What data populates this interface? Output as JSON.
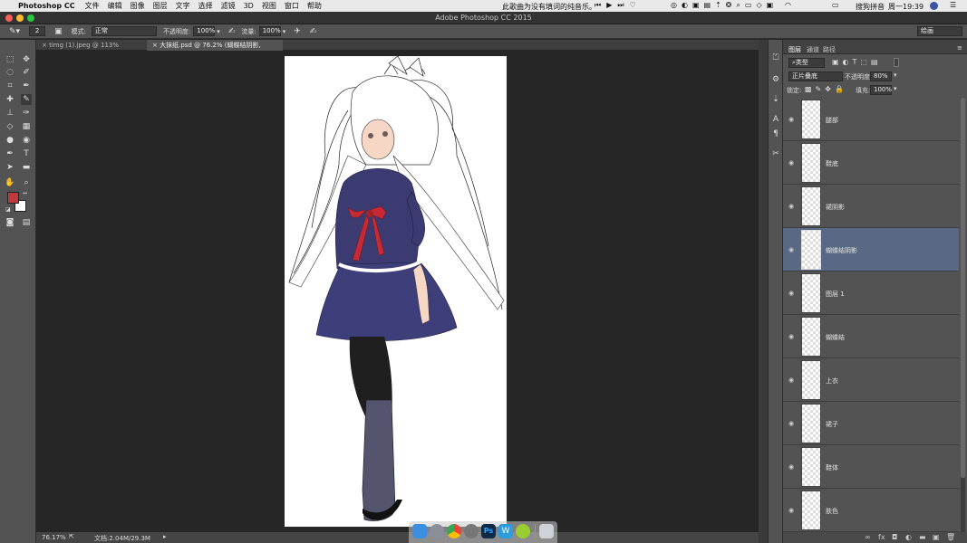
{
  "menubar": {
    "app": "Photoshop CC",
    "items": [
      "文件",
      "编辑",
      "图像",
      "图层",
      "文字",
      "选择",
      "滤镜",
      "3D",
      "视图",
      "窗口",
      "帮助"
    ],
    "now_playing": "此歌曲为没有填词的纯音乐。",
    "input_method": "搜狗拼音",
    "clock": "周一19:39"
  },
  "window": {
    "title": "Adobe Photoshop CC 2015"
  },
  "options": {
    "brush_size": "2",
    "mode_label": "模式:",
    "mode_value": "正常",
    "opacity_label": "不透明度:",
    "opacity_value": "100%",
    "flow_label": "流量:",
    "flow_value": "100%",
    "workspace": "绘画"
  },
  "tabs": [
    {
      "label": "timg (1).jpeg @ 113%(RGB/8#)"
    },
    {
      "label": "大抹纸.psd @ 76.2% (蝴蝶结阴影, RGB/8#)"
    }
  ],
  "status": {
    "zoom": "76.17%",
    "doc_size": "文档:2.04M/29.3M"
  },
  "layers_panel": {
    "tabs": [
      "图层",
      "通道",
      "路径"
    ],
    "filter_kind": "类型",
    "blend_mode": "正片叠底",
    "opacity_label": "不透明度:",
    "opacity_value": "80%",
    "lock_label": "锁定:",
    "fill_label": "填充:",
    "fill_value": "100%",
    "layers": [
      {
        "name": "腿部",
        "selected": false
      },
      {
        "name": "鞋底",
        "selected": false
      },
      {
        "name": "裙阴影",
        "selected": false
      },
      {
        "name": "蝴蝶结阴影",
        "selected": true
      },
      {
        "name": "图层 1",
        "selected": false
      },
      {
        "name": "蝴蝶结",
        "selected": false
      },
      {
        "name": "上衣",
        "selected": false
      },
      {
        "name": "裙子",
        "selected": false
      },
      {
        "name": "鞋体",
        "selected": false
      },
      {
        "name": "肤色",
        "selected": false
      }
    ]
  },
  "colors": {
    "foreground": "#c0393f",
    "background": "#ffffff",
    "selected_layer": "#596983"
  },
  "dock": {
    "apps": [
      "finder-icon",
      "launchpad-icon",
      "chrome-icon",
      "system-preferences-icon",
      "photoshop-icon",
      "wps-icon",
      "app-icon",
      "trash-icon"
    ],
    "ps_label": "Ps"
  }
}
